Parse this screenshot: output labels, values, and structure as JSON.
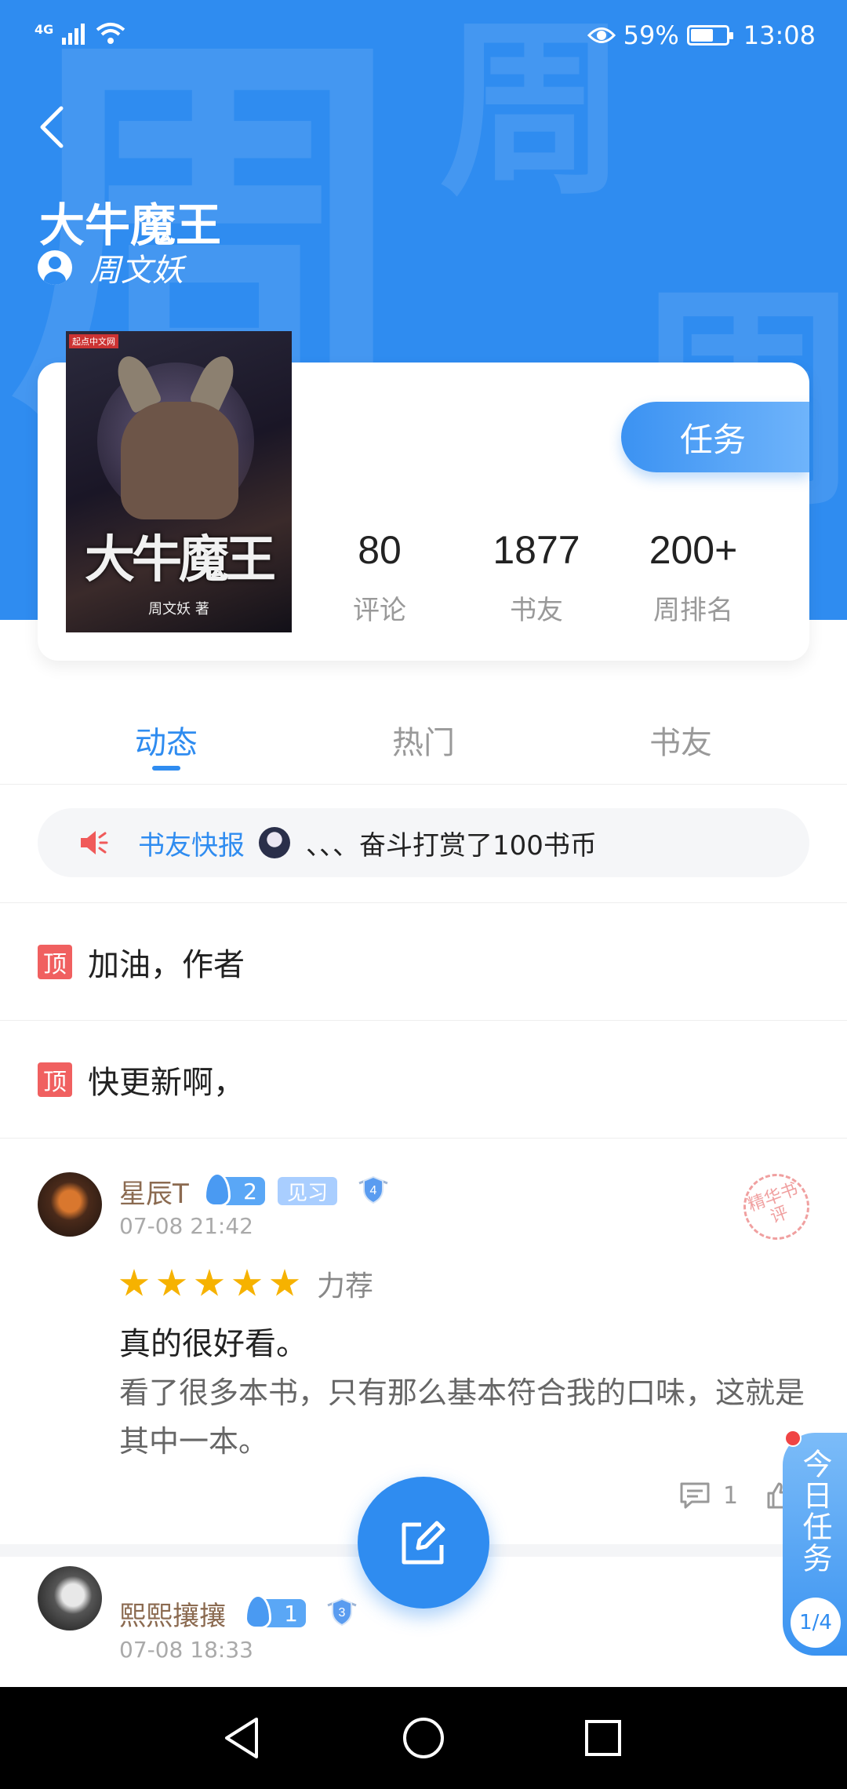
{
  "status_bar": {
    "network": "4G",
    "battery_percent": "59%",
    "battery_level": 0.59,
    "time": "13:08"
  },
  "watermark_char": "周",
  "book": {
    "title": "大牛魔王",
    "author": "周文妖",
    "cover": {
      "badge": "起点中文网",
      "title": "大牛魔王",
      "author_line": "周文妖 著"
    }
  },
  "task_button": "任务",
  "stats": [
    {
      "value": "80",
      "label": "评论"
    },
    {
      "value": "1877",
      "label": "书友"
    },
    {
      "value": "200+",
      "label": "周排名"
    }
  ],
  "tabs": [
    {
      "label": "动态",
      "active": true
    },
    {
      "label": "热门",
      "active": false
    },
    {
      "label": "书友",
      "active": false
    }
  ],
  "news": {
    "label": "书友快报",
    "text": "、、、奋斗打赏了100书币"
  },
  "pinned": [
    {
      "badge": "顶",
      "text": "加油，作者"
    },
    {
      "badge": "顶",
      "text": "快更新啊，"
    }
  ],
  "reviews": [
    {
      "user": "星辰T",
      "level": "2",
      "rank_tag": "见习",
      "fan_level": "4",
      "time": "07-08 21:42",
      "stamp": "精华书评",
      "rating": 5,
      "rating_label": "力荐",
      "title": "真的很好看。",
      "body": "看了很多本书，只有那么基本符合我的口味，这就是其中一本。",
      "reply_count": "1"
    },
    {
      "user": "熙熙攘攘",
      "level": "1",
      "fan_level": "3",
      "time": "07-08 18:33"
    }
  ],
  "daily_task": {
    "label": "今日任务",
    "progress": "1/4"
  },
  "colors": {
    "primary": "#2f8cf0",
    "pin_badge": "#f06060",
    "star": "#f6b200",
    "username": "#8b6a50"
  }
}
